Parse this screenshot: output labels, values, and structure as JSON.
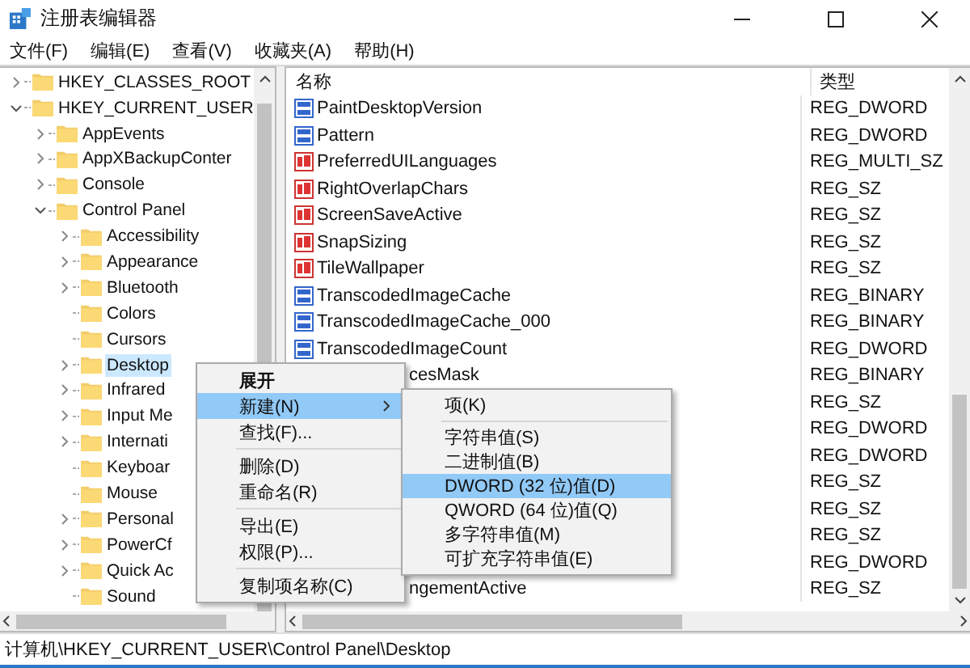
{
  "window": {
    "title": "注册表编辑器"
  },
  "menu_bar": [
    "文件(F)",
    "编辑(E)",
    "查看(V)",
    "收藏夹(A)",
    "帮助(H)"
  ],
  "tree": {
    "items": [
      {
        "label": "HKEY_CLASSES_ROOT",
        "expanded": false,
        "selected": false
      },
      {
        "label": "HKEY_CURRENT_USER",
        "expanded": true,
        "selected": false,
        "children": [
          {
            "label": "AppEvents",
            "expanded": false,
            "selected": false
          },
          {
            "label": "AppXBackupConter",
            "expanded": false,
            "selected": false
          },
          {
            "label": "Console",
            "expanded": false,
            "selected": false
          },
          {
            "label": "Control Panel",
            "expanded": true,
            "selected": false,
            "children": [
              {
                "label": "Accessibility",
                "expanded": false,
                "selected": false
              },
              {
                "label": "Appearance",
                "expanded": false,
                "selected": false
              },
              {
                "label": "Bluetooth",
                "expanded": false,
                "selected": false
              },
              {
                "label": "Colors",
                "selected": false
              },
              {
                "label": "Cursors",
                "selected": false
              },
              {
                "label": "Desktop",
                "expanded": false,
                "selected": true
              },
              {
                "label": "Infrared",
                "expanded": false,
                "selected": false
              },
              {
                "label": "Input Me",
                "expanded": false,
                "selected": false
              },
              {
                "label": "Internati",
                "expanded": false,
                "selected": false
              },
              {
                "label": "Keyboar",
                "selected": false
              },
              {
                "label": "Mouse",
                "selected": false
              },
              {
                "label": "Personal",
                "expanded": false,
                "selected": false
              },
              {
                "label": "PowerCf",
                "expanded": false,
                "selected": false
              },
              {
                "label": "Quick Ac",
                "expanded": false,
                "selected": false
              },
              {
                "label": "Sound",
                "selected": false
              }
            ]
          }
        ]
      }
    ]
  },
  "values": {
    "columns": [
      "名称",
      "类型"
    ],
    "rows": [
      {
        "kind": "binary",
        "name": "PaintDesktopVersion",
        "type": "REG_DWORD"
      },
      {
        "kind": "binary",
        "name": "Pattern",
        "type": "REG_DWORD"
      },
      {
        "kind": "string",
        "name": "PreferredUILanguages",
        "type": "REG_MULTI_SZ"
      },
      {
        "kind": "string",
        "name": "RightOverlapChars",
        "type": "REG_SZ"
      },
      {
        "kind": "string",
        "name": "ScreenSaveActive",
        "type": "REG_SZ"
      },
      {
        "kind": "string",
        "name": "SnapSizing",
        "type": "REG_SZ"
      },
      {
        "kind": "string",
        "name": "TileWallpaper",
        "type": "REG_SZ"
      },
      {
        "kind": "binary",
        "name": "TranscodedImageCache",
        "type": "REG_BINARY"
      },
      {
        "kind": "binary",
        "name": "TranscodedImageCache_000",
        "type": "REG_BINARY"
      },
      {
        "kind": "binary",
        "name": "TranscodedImageCount",
        "type": "REG_DWORD"
      },
      {
        "kind": "covered",
        "name": "cesMask",
        "type": "REG_BINARY"
      },
      {
        "kind": "covered",
        "type": "REG_SZ"
      },
      {
        "kind": "covered",
        "type": "REG_DWORD"
      },
      {
        "kind": "covered",
        "type": "REG_DWORD"
      },
      {
        "kind": "covered",
        "type": "REG_SZ"
      },
      {
        "kind": "covered",
        "type": "REG_SZ"
      },
      {
        "kind": "covered",
        "type": "REG_SZ"
      },
      {
        "kind": "covered",
        "type": "REG_DWORD"
      },
      {
        "kind": "covered",
        "name": "ngementActive",
        "type": "REG_SZ"
      }
    ]
  },
  "context_menu": {
    "items": [
      {
        "kind": "item",
        "label": "展开",
        "default": true,
        "selected": false
      },
      {
        "kind": "item",
        "label": "新建(N)",
        "selected": true,
        "submenu": true
      },
      {
        "kind": "item",
        "label": "查找(F)...",
        "selected": false
      },
      {
        "kind": "separator"
      },
      {
        "kind": "item",
        "label": "删除(D)",
        "selected": false
      },
      {
        "kind": "item",
        "label": "重命名(R)",
        "selected": false
      },
      {
        "kind": "separator"
      },
      {
        "kind": "item",
        "label": "导出(E)",
        "selected": false
      },
      {
        "kind": "item",
        "label": "权限(P)...",
        "selected": false
      },
      {
        "kind": "separator"
      },
      {
        "kind": "item",
        "label": "复制项名称(C)",
        "selected": false
      }
    ]
  },
  "submenu": {
    "items": [
      {
        "kind": "item",
        "label": "项(K)",
        "selected": false
      },
      {
        "kind": "separator"
      },
      {
        "kind": "item",
        "label": "字符串值(S)",
        "selected": false
      },
      {
        "kind": "item",
        "label": "二进制值(B)",
        "selected": false
      },
      {
        "kind": "item",
        "label": "DWORD (32 位)值(D)",
        "selected": true
      },
      {
        "kind": "item",
        "label": "QWORD (64 位)值(Q)",
        "selected": false
      },
      {
        "kind": "item",
        "label": "多字符串值(M)",
        "selected": false
      },
      {
        "kind": "item",
        "label": "可扩充字符串值(E)",
        "selected": false
      }
    ]
  },
  "status_bar": "计算机\\HKEY_CURRENT_USER\\Control Panel\\Desktop"
}
